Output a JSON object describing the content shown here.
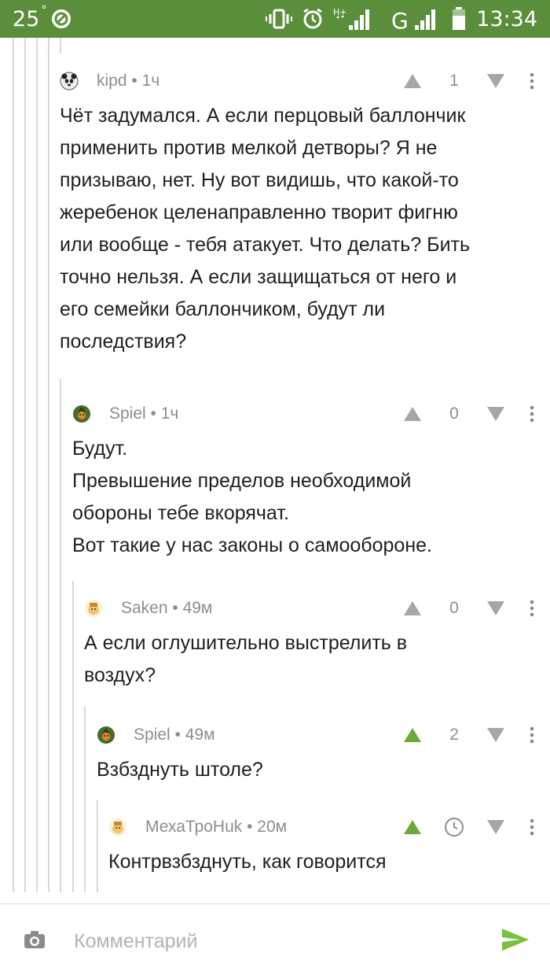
{
  "status_bar": {
    "temperature": "25",
    "degree": "°",
    "time": "13:34",
    "icons": [
      "no-sign-icon",
      "vibrate-icon",
      "alarm-icon",
      "hplus-data-icon",
      "signal-icon",
      "g-network-icon",
      "battery-icon"
    ],
    "network_label": "G",
    "data_label": "H+"
  },
  "colors": {
    "status_bar_bg": "#5a8e3a",
    "upvote_active": "#6aa93a",
    "arrow_inactive": "#a6a6a6",
    "send_icon": "#7bbf3e"
  },
  "comments": [
    {
      "author": "kipd",
      "time": "1ч",
      "score": "1",
      "upvoted": false,
      "avatar_icon": "panda-avatar-icon",
      "body": [
        "Чёт задумался. А если перцовый баллончик",
        "применить против мелкой детворы? Я не",
        "призываю, нет. Ну вот видишь, что какой-то",
        "жеребенок целенаправленно творит фигню",
        "или вообще - тебя атакует. Что делать? Бить",
        "точно нельзя. А если защищаться от него и",
        "его семейки баллончиком, будут ли",
        "последствия?"
      ]
    },
    {
      "author": "Spiel",
      "time": "1ч",
      "score": "0",
      "upvoted": false,
      "avatar_icon": "warrior-avatar-icon",
      "body": [
        "Будут.",
        "Превышение пределов необходимой",
        "обороны тебе вкорячат.",
        "Вот такие у нас законы о самообороне."
      ]
    },
    {
      "author": "Saken",
      "time": "49м",
      "score": "0",
      "upvoted": false,
      "avatar_icon": "cartoon-avatar-icon",
      "body": [
        "А если оглушительно выстрелить в",
        "воздух?"
      ]
    },
    {
      "author": "Spiel",
      "time": "49м",
      "score": "2",
      "upvoted": true,
      "avatar_icon": "warrior-avatar-icon",
      "body": [
        "Взбзднуть штоле?"
      ]
    },
    {
      "author": "МехаТроНuk",
      "time": "20м",
      "score": "",
      "upvoted": true,
      "pending": true,
      "avatar_icon": "cartoon-avatar-icon",
      "body": [
        "Контрвзбзднуть, как говорится"
      ]
    }
  ],
  "composer": {
    "placeholder": "Комментарий",
    "camera_icon": "camera-icon",
    "send_icon": "send-icon"
  }
}
